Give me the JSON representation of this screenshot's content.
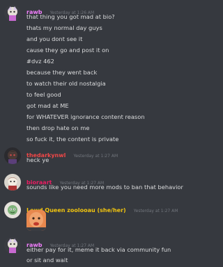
{
  "messages": [
    {
      "author": "rawb",
      "author_color": "#f47fff",
      "timestamp": "Yesterday at 1:26 AM",
      "lines": [
        "that thing you got mad at bio?",
        "thats my normal day guys",
        "and you dont see it",
        "cause they go and post it on",
        "#dvz 462",
        "because they went back",
        "to watch their old nostalgia",
        "to feel good",
        "got mad at ME",
        "for WHATEVER ignorance content reason",
        "then drop hate on me",
        "so fuck it, the content is private"
      ]
    },
    {
      "author": "thedarkynwl",
      "author_color": "#f04747",
      "timestamp": "Yesterday at 1:27 AM",
      "lines": [
        "heck ye"
      ]
    },
    {
      "author": "bioraart",
      "author_color": "#e91e63",
      "timestamp": "Yesterday at 1:27 AM",
      "lines": [
        "sounds like you need more mods to ban that behavior"
      ]
    },
    {
      "author": "Lewd Queen zoolooau (she/her)",
      "author_color": "#f1c40f",
      "timestamp": "Yesterday at 1:27 AM",
      "lines": []
    },
    {
      "author": "rawb",
      "author_color": "#f47fff",
      "timestamp": "Yesterday at 1:27 AM",
      "lines": [
        "either pay for it, meme it back via community fun",
        "or sit and wait"
      ]
    }
  ]
}
